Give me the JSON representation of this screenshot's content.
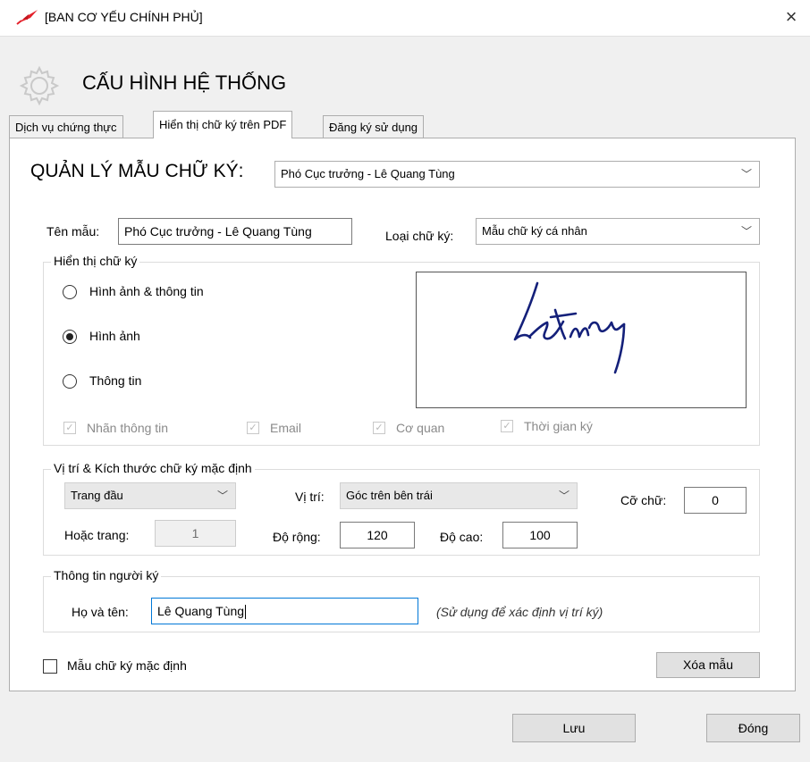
{
  "window": {
    "title": "[BAN CƠ YẾU CHÍNH PHỦ]",
    "close_symbol": "×"
  },
  "header": {
    "title": "CẤU HÌNH HỆ THỐNG"
  },
  "tabs": [
    {
      "label": "Dịch vụ chứng thực",
      "active": false
    },
    {
      "label": "Hiển thị chữ ký trên PDF",
      "active": true
    },
    {
      "label": "Đăng ký sử dụng",
      "active": false
    }
  ],
  "template_manager": {
    "label": "QUẢN LÝ MẪU CHỮ KÝ:",
    "selected": "Phó Cục trưởng - Lê Quang Tùng"
  },
  "template_name": {
    "label": "Tên mẫu:",
    "value": "Phó Cục trưởng - Lê Quang Tùng"
  },
  "signature_type": {
    "label": "Loại chữ ký:",
    "selected": "Mẫu chữ ký cá nhân"
  },
  "display_group": {
    "legend": "Hiển thị chữ ký",
    "radios": [
      {
        "label": "Hình ảnh & thông tin",
        "checked": false
      },
      {
        "label": "Hình ảnh",
        "checked": true
      },
      {
        "label": "Thông tin",
        "checked": false
      }
    ],
    "checkboxes": [
      {
        "label": "Nhãn thông tin",
        "checked": true,
        "enabled": false
      },
      {
        "label": "Email",
        "checked": true,
        "enabled": false
      },
      {
        "label": "Cơ quan",
        "checked": true,
        "enabled": false
      },
      {
        "label": "Thời gian ký",
        "checked": true,
        "enabled": false
      }
    ]
  },
  "position_group": {
    "legend": "Vị trí  & Kích thước chữ ký mặc định",
    "page_select": "Trang đầu",
    "position_label": "Vị trí:",
    "position_select": "Góc trên bên trái",
    "font_size_label": "Cỡ chữ:",
    "font_size_value": "0",
    "or_page_label": "Hoặc trang:",
    "or_page_value": "1",
    "width_label": "Độ rộng:",
    "width_value": "120",
    "height_label": "Độ cao:",
    "height_value": "100"
  },
  "signer_group": {
    "legend": "Thông tin người ký",
    "name_label": "Họ và tên:",
    "name_value": "Lê Quang Tùng",
    "hint": "(Sử dụng để xác định vị trí ký)"
  },
  "default_template": {
    "label": "Mẫu chữ ký mặc định",
    "checked": false
  },
  "buttons": {
    "delete": "Xóa mẫu",
    "save": "Lưu",
    "close": "Đóng"
  },
  "icons": {
    "app": "feather-pen-icon",
    "header": "gear-icon",
    "dropdown": "chevron-down-icon"
  },
  "colors": {
    "app_icon": "#e4202a",
    "focus_border": "#0078d7",
    "hint_text": "#333333"
  }
}
